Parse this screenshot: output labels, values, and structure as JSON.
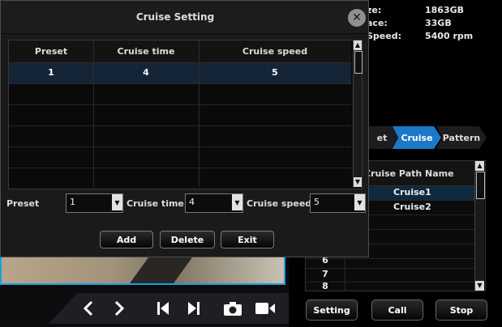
{
  "disk_info": {
    "rows": [
      {
        "label": "ze:",
        "value": "1863GB"
      },
      {
        "label": "ace:",
        "value": "33GB"
      },
      {
        "label": "Speed:",
        "value": "5400 rpm"
      }
    ]
  },
  "ptz_tabs": {
    "items": [
      "et",
      "Cruise",
      "Pattern"
    ],
    "active": "Cruise",
    "scroll_icon": "triangle-up-icon"
  },
  "cruise_path_table": {
    "header": "Cruise Path Name",
    "rows": [
      {
        "num": "",
        "name": "Cruise1"
      },
      {
        "num": "",
        "name": "Cruise2"
      },
      {
        "num": "",
        "name": ""
      },
      {
        "num": "",
        "name": ""
      },
      {
        "num": "",
        "name": ""
      },
      {
        "num": "6",
        "name": ""
      },
      {
        "num": "7",
        "name": ""
      },
      {
        "num": "8",
        "name": ""
      }
    ],
    "selected_row": 0
  },
  "ptz_buttons": {
    "setting": "Setting",
    "call": "Call",
    "stop": "Stop"
  },
  "toolbar": {
    "icons": [
      "prev-icon",
      "next-icon",
      "skip-back-icon",
      "skip-forward-icon",
      "camera-icon",
      "record-icon"
    ]
  },
  "dialog": {
    "title": "Cruise Setting",
    "close_icon": "close-icon",
    "table": {
      "columns": [
        "Preset",
        "Cruise time",
        "Cruise speed"
      ],
      "rows": [
        {
          "preset": "1",
          "time": "4",
          "speed": "5"
        },
        {
          "preset": "",
          "time": "",
          "speed": ""
        },
        {
          "preset": "",
          "time": "",
          "speed": ""
        },
        {
          "preset": "",
          "time": "",
          "speed": ""
        },
        {
          "preset": "",
          "time": "",
          "speed": ""
        },
        {
          "preset": "",
          "time": "",
          "speed": ""
        }
      ],
      "selected_row": 0
    },
    "form": {
      "preset_label": "Preset",
      "preset_value": "1",
      "time_label": "Cruise time",
      "time_value": "4",
      "speed_label": "Cruise speed",
      "speed_value": "5"
    },
    "buttons": {
      "add": "Add",
      "delete": "Delete",
      "exit": "Exit"
    }
  },
  "colors": {
    "accent": "#1c79c7",
    "video_border": "#1a9fe0",
    "selected_row": "#142538"
  }
}
